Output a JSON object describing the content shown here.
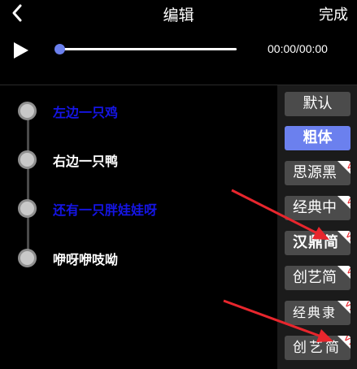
{
  "header": {
    "title": "编辑",
    "done_label": "完成"
  },
  "player": {
    "time": "00:00/00:00",
    "progress": 0
  },
  "subtitles": [
    {
      "text": "左边一只鸡",
      "color": "#1515e6"
    },
    {
      "text": "右边一只鸭",
      "color": "#ffffff"
    },
    {
      "text": "还有一只胖娃娃呀",
      "color": "#1515e6"
    },
    {
      "text": "咿呀咿吱呦",
      "color": "#ffffff"
    }
  ],
  "fonts": [
    {
      "label": "默认",
      "vip": false,
      "selected": false
    },
    {
      "label": "粗体",
      "vip": false,
      "selected": true
    },
    {
      "label": "思源黑",
      "vip": true,
      "selected": false
    },
    {
      "label": "经典中",
      "vip": true,
      "selected": false
    },
    {
      "label": "汉鼎简",
      "vip": true,
      "selected": false
    },
    {
      "label": "创艺简",
      "vip": true,
      "selected": false
    },
    {
      "label": "经典隶",
      "vip": true,
      "selected": false
    },
    {
      "label": "创艺简",
      "vip": true,
      "selected": false
    }
  ],
  "vip_badge": "VIP",
  "colors": {
    "accent": "#6b80ee",
    "arrow": "#e8262d",
    "highlight_text": "#1515e6"
  }
}
